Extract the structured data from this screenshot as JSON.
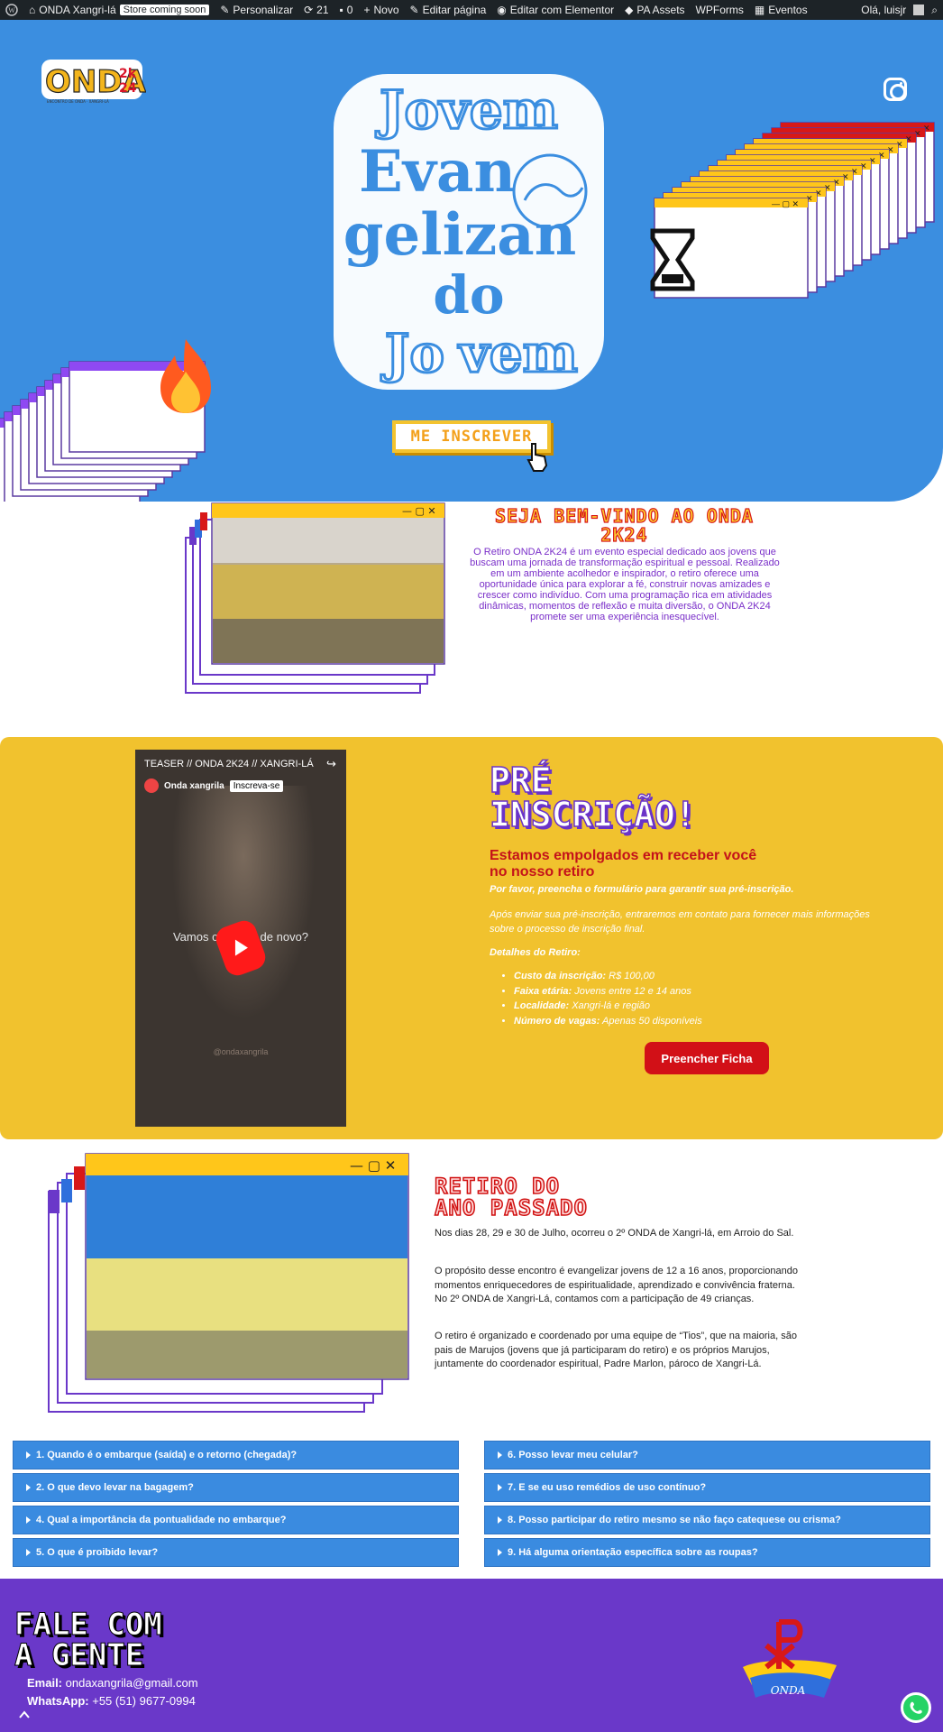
{
  "adminbar": {
    "site": "ONDA Xangri-lá",
    "store_badge": "Store coming soon",
    "customize": "Personalizar",
    "updates": "21",
    "comments": "0",
    "new": "Novo",
    "edit_page": "Editar página",
    "edit_elementor": "Editar com Elementor",
    "pa_assets": "PA Assets",
    "wpforms": "WPForms",
    "events": "Eventos",
    "greeting": "Olá, luisjr"
  },
  "hero": {
    "headline": [
      "Jovem",
      "Evan",
      "gelizan",
      "do",
      "Jo",
      "vem"
    ],
    "cta": "ME INSCREVER",
    "logo_text": "ONDA",
    "logo_year": "2k24",
    "colors": {
      "bg": "#3b8ee0",
      "accent": "#f3c32f"
    }
  },
  "welcome": {
    "title": "SEJA BEM-VINDO AO ONDA 2K24",
    "text": "O Retiro ONDA 2K24 é um evento especial dedicado aos jovens que buscam uma jornada de transformação espiritual e pessoal. Realizado em um ambiente acolhedor e inspirador, o retiro oferece uma oportunidade única para explorar a fé, construir novas amizades e crescer como indivíduo. Com uma programação rica em atividades dinâmicas, momentos de reflexão e muita diversão, o ONDA 2K24 promete ser uma experiência inesquecível."
  },
  "video": {
    "title": "TEASER // ONDA 2K24 // XANGRI-LÁ",
    "channel": "Onda xangrila",
    "subscribe": "Inscreva-se",
    "caption": "Vamos começar de novo?",
    "watermark": "@ondaxangrila"
  },
  "preinscricao": {
    "title_line1": "PRÉ",
    "title_line2": "INSCRIÇÃO!",
    "subtitle": "Estamos empolgados em receber você no nosso retiro",
    "intro": "Por favor, preencha o formulário para garantir sua pré-inscrição.",
    "after": "Após enviar sua pré-inscrição, entraremos em contato para fornecer mais informações sobre o processo de inscrição final.",
    "details_label": "Detalhes do Retiro:",
    "details": [
      {
        "k": "Custo da inscrição:",
        "v": "R$ 100,00"
      },
      {
        "k": "Faixa etária:",
        "v": "Jovens entre 12 e 14 anos"
      },
      {
        "k": "Localidade:",
        "v": "Xangri-lá e região"
      },
      {
        "k": "Número de vagas:",
        "v": "Apenas 50 disponíveis"
      }
    ],
    "button": "Preencher Ficha"
  },
  "lastyear": {
    "title_line1": "RETIRO DO",
    "title_line2": "ANO PASSADO",
    "p1": "Nos dias 28, 29 e 30 de Julho, ocorreu o 2º ONDA de Xangri-lá, em Arroio do Sal.",
    "p2": "O propósito desse encontro é evangelizar jovens de 12 a 16 anos, proporcionando momentos enriquecedores de espiritualidade, aprendizado e convivência fraterna. No 2º ONDA de Xangri-Lá, contamos com a participação de 49 crianças.",
    "p3": "O retiro é organizado e coordenado por uma equipe de “Tios”, que na maioria, são pais de Marujos (jovens que já participaram do retiro) e os próprios Marujos, juntamente do coordenador espiritual, Padre Marlon, pároco de Xangri-Lá."
  },
  "faq": {
    "left": [
      "1. Quando é o embarque (saída) e o retorno (chegada)?",
      "2. O que devo levar na bagagem?",
      "4. Qual a importância da pontualidade no embarque?",
      "5. O que é proibido levar?"
    ],
    "right": [
      "6. Posso levar meu celular?",
      "7. E se eu uso remédios de uso contínuo?",
      "8. Posso participar do retiro mesmo se não faço catequese ou crisma?",
      "9. Há alguma orientação específica sobre as roupas?"
    ]
  },
  "footer": {
    "title_line1": "FALE COM",
    "title_line2": "A GENTE",
    "email_label": "Email:",
    "email": "ondaxangrila@gmail.com",
    "whatsapp_label": "WhatsApp:",
    "whatsapp": "+55 (51) 9677-0994",
    "logo_text": "ONDA"
  }
}
